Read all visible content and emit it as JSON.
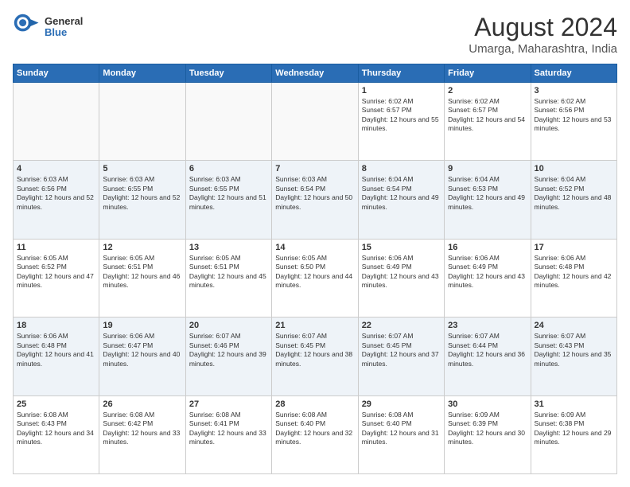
{
  "header": {
    "logo_general": "General",
    "logo_blue": "Blue",
    "month_title": "August 2024",
    "location": "Umarga, Maharashtra, India"
  },
  "days_of_week": [
    "Sunday",
    "Monday",
    "Tuesday",
    "Wednesday",
    "Thursday",
    "Friday",
    "Saturday"
  ],
  "weeks": [
    [
      {
        "day": "",
        "empty": true
      },
      {
        "day": "",
        "empty": true
      },
      {
        "day": "",
        "empty": true
      },
      {
        "day": "",
        "empty": true
      },
      {
        "day": "1",
        "sunrise": "6:02 AM",
        "sunset": "6:57 PM",
        "daylight": "12 hours and 55 minutes."
      },
      {
        "day": "2",
        "sunrise": "6:02 AM",
        "sunset": "6:57 PM",
        "daylight": "12 hours and 54 minutes."
      },
      {
        "day": "3",
        "sunrise": "6:02 AM",
        "sunset": "6:56 PM",
        "daylight": "12 hours and 53 minutes."
      }
    ],
    [
      {
        "day": "4",
        "sunrise": "6:03 AM",
        "sunset": "6:56 PM",
        "daylight": "12 hours and 52 minutes."
      },
      {
        "day": "5",
        "sunrise": "6:03 AM",
        "sunset": "6:55 PM",
        "daylight": "12 hours and 52 minutes."
      },
      {
        "day": "6",
        "sunrise": "6:03 AM",
        "sunset": "6:55 PM",
        "daylight": "12 hours and 51 minutes."
      },
      {
        "day": "7",
        "sunrise": "6:03 AM",
        "sunset": "6:54 PM",
        "daylight": "12 hours and 50 minutes."
      },
      {
        "day": "8",
        "sunrise": "6:04 AM",
        "sunset": "6:54 PM",
        "daylight": "12 hours and 49 minutes."
      },
      {
        "day": "9",
        "sunrise": "6:04 AM",
        "sunset": "6:53 PM",
        "daylight": "12 hours and 49 minutes."
      },
      {
        "day": "10",
        "sunrise": "6:04 AM",
        "sunset": "6:52 PM",
        "daylight": "12 hours and 48 minutes."
      }
    ],
    [
      {
        "day": "11",
        "sunrise": "6:05 AM",
        "sunset": "6:52 PM",
        "daylight": "12 hours and 47 minutes."
      },
      {
        "day": "12",
        "sunrise": "6:05 AM",
        "sunset": "6:51 PM",
        "daylight": "12 hours and 46 minutes."
      },
      {
        "day": "13",
        "sunrise": "6:05 AM",
        "sunset": "6:51 PM",
        "daylight": "12 hours and 45 minutes."
      },
      {
        "day": "14",
        "sunrise": "6:05 AM",
        "sunset": "6:50 PM",
        "daylight": "12 hours and 44 minutes."
      },
      {
        "day": "15",
        "sunrise": "6:06 AM",
        "sunset": "6:49 PM",
        "daylight": "12 hours and 43 minutes."
      },
      {
        "day": "16",
        "sunrise": "6:06 AM",
        "sunset": "6:49 PM",
        "daylight": "12 hours and 43 minutes."
      },
      {
        "day": "17",
        "sunrise": "6:06 AM",
        "sunset": "6:48 PM",
        "daylight": "12 hours and 42 minutes."
      }
    ],
    [
      {
        "day": "18",
        "sunrise": "6:06 AM",
        "sunset": "6:48 PM",
        "daylight": "12 hours and 41 minutes."
      },
      {
        "day": "19",
        "sunrise": "6:06 AM",
        "sunset": "6:47 PM",
        "daylight": "12 hours and 40 minutes."
      },
      {
        "day": "20",
        "sunrise": "6:07 AM",
        "sunset": "6:46 PM",
        "daylight": "12 hours and 39 minutes."
      },
      {
        "day": "21",
        "sunrise": "6:07 AM",
        "sunset": "6:45 PM",
        "daylight": "12 hours and 38 minutes."
      },
      {
        "day": "22",
        "sunrise": "6:07 AM",
        "sunset": "6:45 PM",
        "daylight": "12 hours and 37 minutes."
      },
      {
        "day": "23",
        "sunrise": "6:07 AM",
        "sunset": "6:44 PM",
        "daylight": "12 hours and 36 minutes."
      },
      {
        "day": "24",
        "sunrise": "6:07 AM",
        "sunset": "6:43 PM",
        "daylight": "12 hours and 35 minutes."
      }
    ],
    [
      {
        "day": "25",
        "sunrise": "6:08 AM",
        "sunset": "6:43 PM",
        "daylight": "12 hours and 34 minutes."
      },
      {
        "day": "26",
        "sunrise": "6:08 AM",
        "sunset": "6:42 PM",
        "daylight": "12 hours and 33 minutes."
      },
      {
        "day": "27",
        "sunrise": "6:08 AM",
        "sunset": "6:41 PM",
        "daylight": "12 hours and 33 minutes."
      },
      {
        "day": "28",
        "sunrise": "6:08 AM",
        "sunset": "6:40 PM",
        "daylight": "12 hours and 32 minutes."
      },
      {
        "day": "29",
        "sunrise": "6:08 AM",
        "sunset": "6:40 PM",
        "daylight": "12 hours and 31 minutes."
      },
      {
        "day": "30",
        "sunrise": "6:09 AM",
        "sunset": "6:39 PM",
        "daylight": "12 hours and 30 minutes."
      },
      {
        "day": "31",
        "sunrise": "6:09 AM",
        "sunset": "6:38 PM",
        "daylight": "12 hours and 29 minutes."
      }
    ]
  ]
}
